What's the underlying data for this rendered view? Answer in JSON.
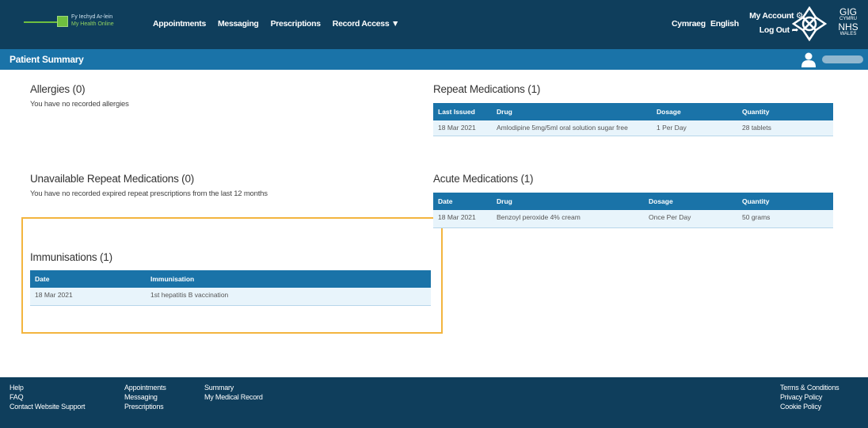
{
  "header": {
    "logo_line1": "Fy Iechyd Ar-lein",
    "logo_line1_hl": "",
    "logo_line2": "My Health Online",
    "nav": [
      "Appointments",
      "Messaging",
      "Prescriptions",
      "Record Access ▼"
    ],
    "lang_cy": "Cymraeg",
    "lang_en": "English",
    "my_account": "My Account ⚙",
    "log_out": "Log Out ➦",
    "brand": {
      "line1": "GIG",
      "line2": "CYMRU",
      "line3": "NHS",
      "line4": "WALES"
    }
  },
  "subheader": {
    "title": "Patient Summary",
    "user_icon": "user-icon"
  },
  "allergies": {
    "title": "Allergies (0)",
    "text": "You have no recorded allergies"
  },
  "unavailable_repeat": {
    "title": "Unavailable Repeat Medications (0)",
    "text": "You have no recorded expired repeat prescriptions from the last 12 months"
  },
  "immunisations": {
    "title": "Immunisations (1)",
    "headers": [
      "Date",
      "Immunisation"
    ],
    "rows": [
      [
        "18 Mar 2021",
        "1st hepatitis B vaccination"
      ]
    ]
  },
  "repeat_meds": {
    "title": "Repeat Medications (1)",
    "headers": [
      "Last Issued",
      "Drug",
      "Dosage",
      "Quantity"
    ],
    "rows": [
      [
        "18 Mar 2021",
        "Amlodipine 5mg/5ml oral solution sugar free",
        "1 Per Day",
        "28 tablets"
      ]
    ]
  },
  "acute_meds": {
    "title": "Acute Medications (1)",
    "headers": [
      "Date",
      "Drug",
      "Dosage",
      "Quantity"
    ],
    "rows": [
      [
        "18 Mar 2021",
        "Benzoyl peroxide 4% cream",
        "Once Per Day",
        "50 grams"
      ]
    ]
  },
  "footer": {
    "col1": [
      "Help",
      "FAQ",
      "Contact Website Support"
    ],
    "col2": [
      "Appointments",
      "Messaging",
      "Prescriptions"
    ],
    "col3": [
      "Summary",
      "My Medical Record"
    ],
    "col4": [
      "Terms & Conditions",
      "Privacy Policy",
      "Cookie Policy"
    ]
  },
  "colors": {
    "nav_bg": "#0f3e5c",
    "accent": "#1a73a8",
    "row_bg": "#e8f4fb",
    "highlight": "#f3b53f"
  }
}
